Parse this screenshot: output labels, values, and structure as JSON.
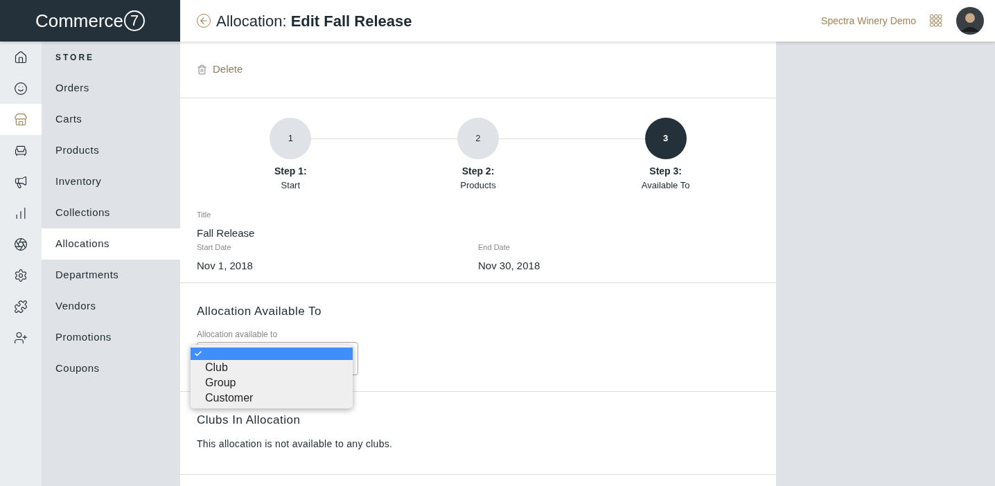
{
  "logo": {
    "text": "Commerce",
    "mark": "7"
  },
  "header": {
    "title_prefix": "Allocation:",
    "title_bold": "Edit Fall Release",
    "account": "Spectra Winery Demo"
  },
  "rail": [
    {
      "kind": "home",
      "selected": false
    },
    {
      "kind": "smile",
      "selected": false
    },
    {
      "kind": "store",
      "selected": true
    },
    {
      "kind": "armchair",
      "selected": false
    },
    {
      "kind": "megaphone",
      "selected": false
    },
    {
      "kind": "chart",
      "selected": false
    },
    {
      "kind": "aperture",
      "selected": false
    },
    {
      "kind": "gear",
      "selected": false
    },
    {
      "kind": "puzzle",
      "selected": false
    },
    {
      "kind": "users",
      "selected": false
    }
  ],
  "menu": {
    "heading": "STORE",
    "items": [
      {
        "label": "Orders",
        "selected": false
      },
      {
        "label": "Carts",
        "selected": false
      },
      {
        "label": "Products",
        "selected": false
      },
      {
        "label": "Inventory",
        "selected": false
      },
      {
        "label": "Collections",
        "selected": false
      },
      {
        "label": "Allocations",
        "selected": true
      },
      {
        "label": "Departments",
        "selected": false
      },
      {
        "label": "Vendors",
        "selected": false
      },
      {
        "label": "Promotions",
        "selected": false
      },
      {
        "label": "Coupons",
        "selected": false
      }
    ]
  },
  "delete_label": "Delete",
  "steps": [
    {
      "number": "1",
      "label": "Step 1:",
      "sublabel": "Start",
      "selected": false
    },
    {
      "number": "2",
      "label": "Step 2:",
      "sublabel": "Products",
      "selected": false
    },
    {
      "number": "3",
      "label": "Step 3:",
      "sublabel": "Available To",
      "selected": true
    }
  ],
  "details": {
    "title_label": "Title",
    "title": "Fall Release",
    "start_label": "Start Date",
    "start": "Nov 1, 2018",
    "end_label": "End Date",
    "end": "Nov 30, 2018"
  },
  "available_to": {
    "heading": "Allocation Available To",
    "field_label": "Allocation available to",
    "blank_option_selected": true,
    "options": [
      {
        "label": "Club",
        "selected": false
      },
      {
        "label": "Group",
        "selected": false
      },
      {
        "label": "Customer",
        "selected": false
      }
    ]
  },
  "clubs": {
    "heading": "Clubs In Allocation",
    "text": "This allocation is not available to any clubs."
  }
}
